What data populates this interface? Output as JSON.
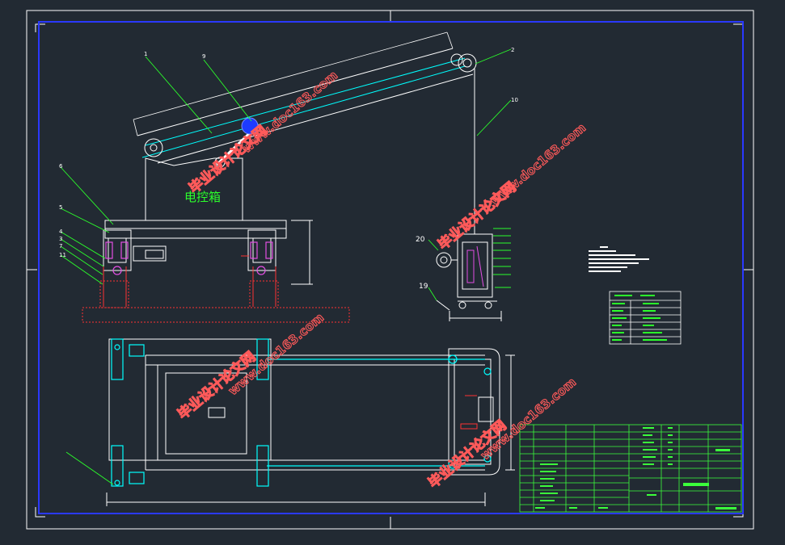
{
  "cad": {
    "colors": {
      "background": "#222a33",
      "frame": "#ffffff",
      "border": "#2a39ff",
      "geometry": "#ffffff",
      "centerline": "#00ffff",
      "leaders": "#2bff2b",
      "cut": "#ff3333",
      "hatch": "#ff3333",
      "parts": "#e34fe3",
      "motor": "#1d3bff",
      "table": "#3bff3b",
      "watermark": "#ff5a5a"
    },
    "control_box_label": "电控箱",
    "part_numbers": {
      "p1": "1",
      "p2": "2",
      "p3": "3",
      "p4": "4",
      "p5": "5",
      "p6": "6",
      "p7": "7",
      "p9": "9",
      "p10": "10",
      "p11": "11",
      "p19": "19",
      "p20": "20"
    },
    "watermarks": {
      "cn": "毕业设计论文网",
      "url": "www.doc163.com"
    }
  }
}
